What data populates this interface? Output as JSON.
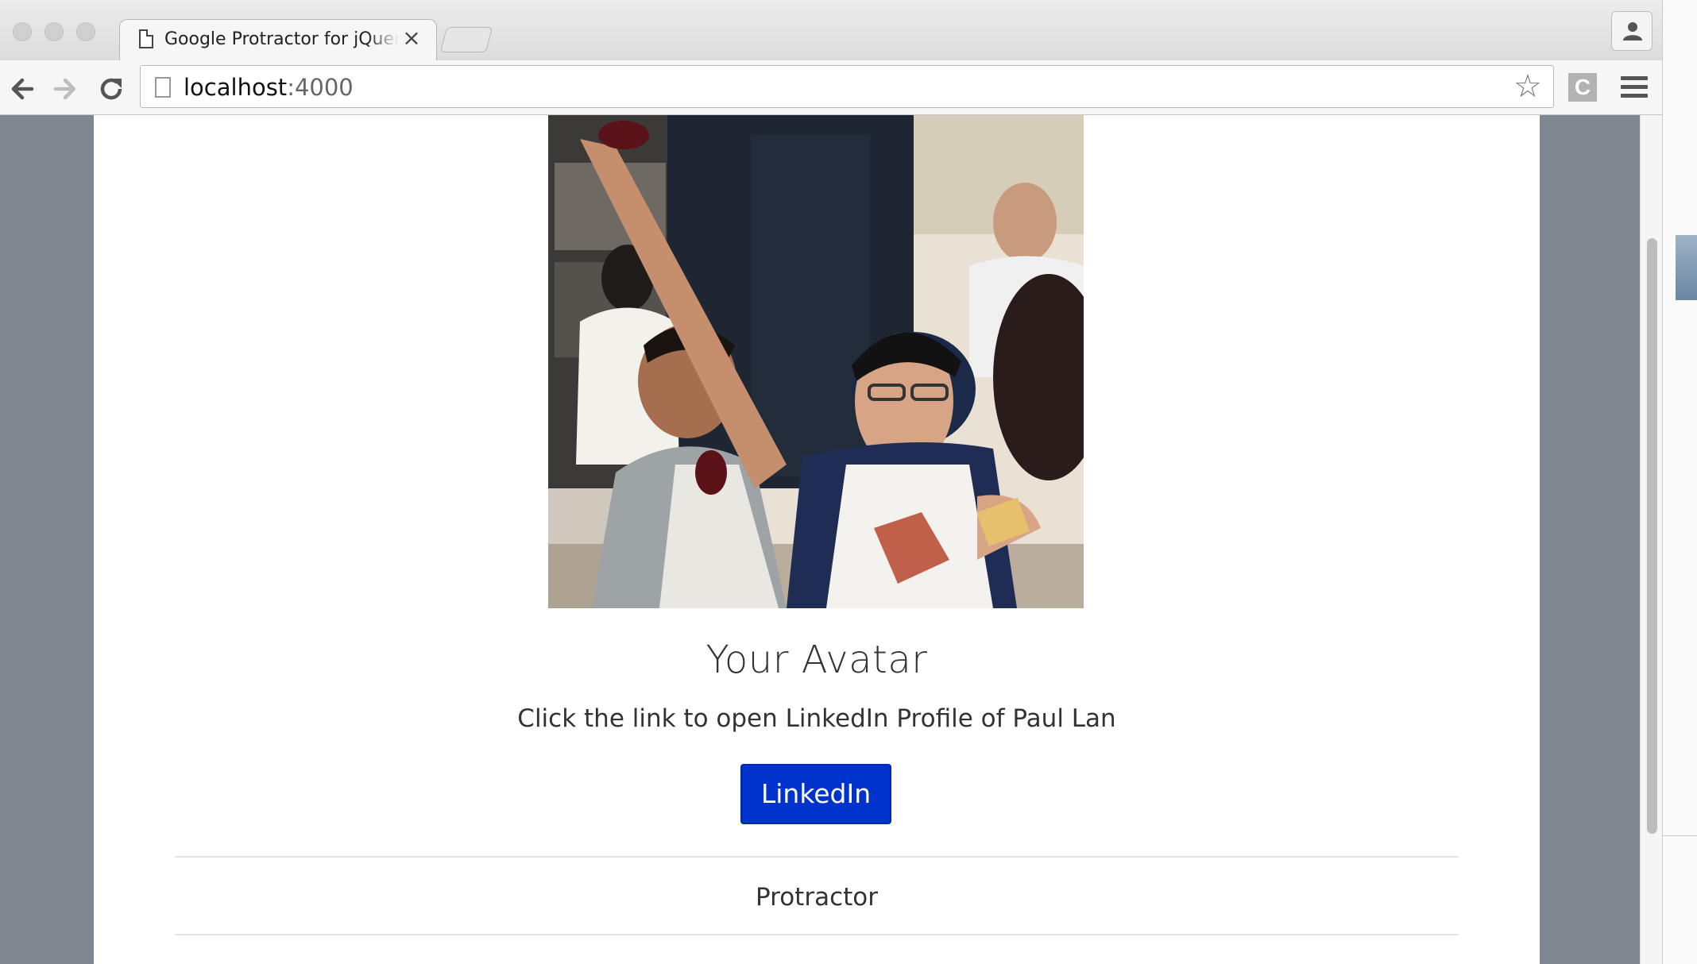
{
  "browser": {
    "tab_title": "Google Protractor for jQuery",
    "tab_close": "×",
    "url_host": "localhost",
    "url_port": ":4000",
    "extension_label": "C"
  },
  "page": {
    "avatar_alt": "Avatar photo",
    "heading": "Your Avatar",
    "subtext": "Click the link to open LinkedIn Profile of Paul Lan",
    "button_label": "LinkedIn",
    "footer_text": "Protractor"
  },
  "colors": {
    "button_bg": "#0033cc",
    "backdrop": "#7f8791"
  }
}
